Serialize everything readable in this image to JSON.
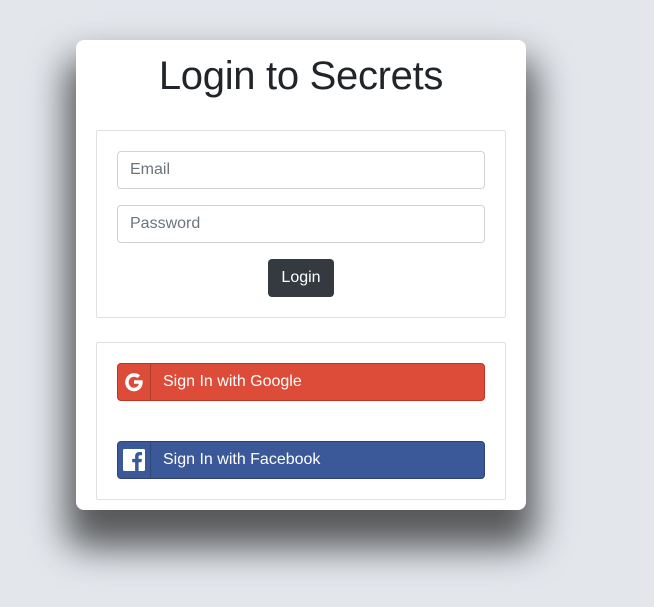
{
  "page": {
    "title": "Login to Secrets"
  },
  "login_form": {
    "email_placeholder": "Email",
    "password_placeholder": "Password",
    "submit_label": "Login"
  },
  "social": {
    "google_label": "Sign In with Google",
    "facebook_label": "Sign In with Facebook",
    "google_icon": "google-icon",
    "facebook_icon": "facebook-icon"
  },
  "colors": {
    "background": "#e3e7ec",
    "login_button": "#343a40",
    "google": "#dd4b39",
    "facebook": "#3b5998"
  }
}
